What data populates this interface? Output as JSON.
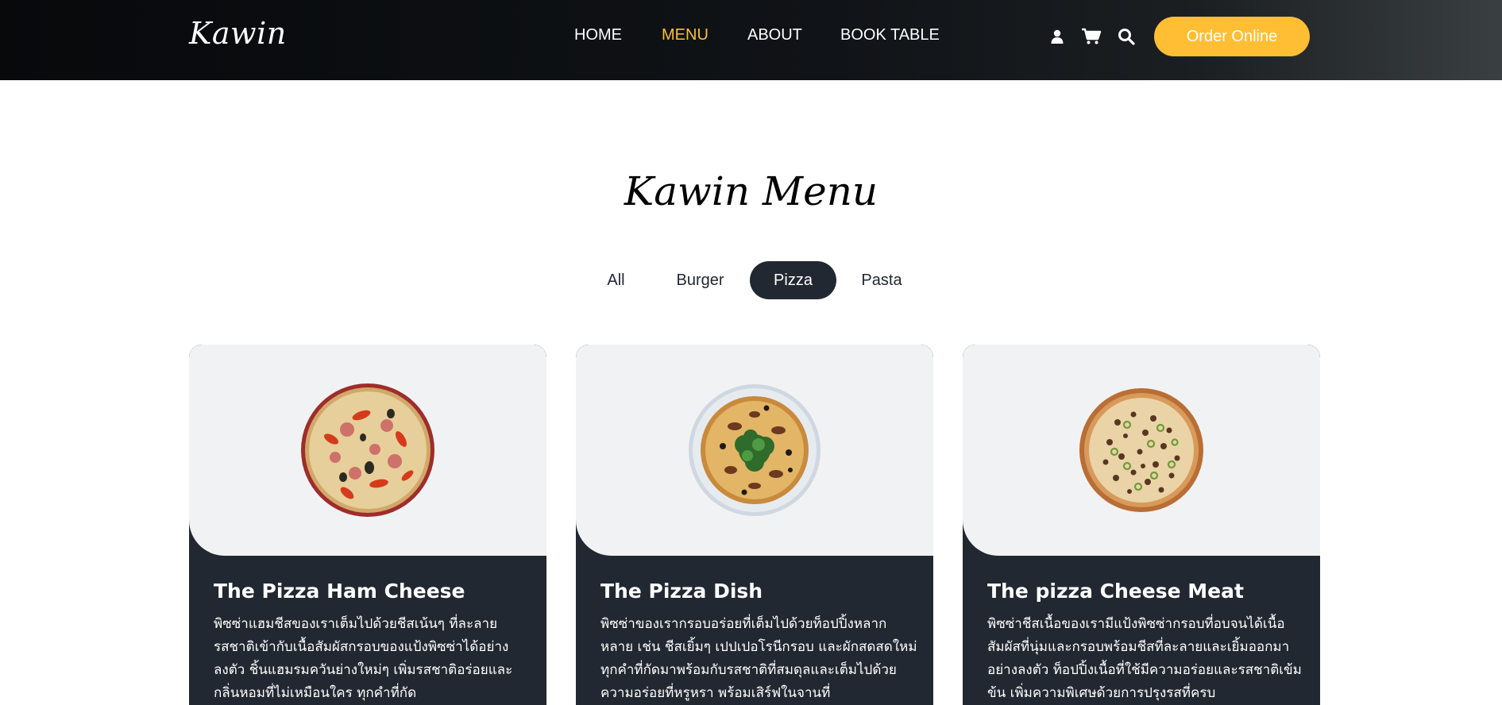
{
  "header": {
    "logo": "Kawin",
    "nav": [
      "HOME",
      "MENU",
      "ABOUT",
      "BOOK TABLE"
    ],
    "active_nav": "MENU",
    "icons": [
      "user-icon",
      "cart-icon",
      "search-icon"
    ],
    "order_button": "Order Online"
  },
  "section": {
    "title": "Kawin Menu",
    "filters": [
      "All",
      "Burger",
      "Pizza",
      "Pasta"
    ],
    "active_filter": "Pizza"
  },
  "colors": {
    "accent": "#ffbe33",
    "dark": "#222831",
    "card_top": "#f1f2f3"
  },
  "cards": [
    {
      "title": "The Pizza Ham Cheese",
      "description": "พิซซ่าแฮมชีสของเราเต็มไปด้วยชีสเน้นๆ ที่ละลายรสชาติเข้ากับเนื้อสัมผัสกรอบของแป้งพิซซ่าได้อย่างลงตัว ชิ้นแฮมรมควันย่างใหม่ๆ เพิ่มรสชาติอร่อยและกลิ่นหอมที่ไม่เหมือนใคร ทุกคำที่กัด",
      "image": "pizza-ham-cheese-image"
    },
    {
      "title": "The Pizza Dish",
      "description": "พิซซ่าของเรากรอบอร่อยที่เต็มไปด้วยท็อปปิ้งหลากหลาย เช่น ชีสเยิ้มๆ เปปเปอโรนีกรอบ และผักสดสดใหม่ ทุกคำที่กัดมาพร้อมกับรสชาติที่สมดุลและเต็มไปด้วยความอร่อยที่หรูหรา พร้อมเสิร์ฟในจานที่",
      "image": "pizza-dish-image"
    },
    {
      "title": "The pizza Cheese Meat",
      "description": "พิซซ่าชีสเนื้อของเรามีแป้งพิซซ่ากรอบที่อบจนได้เนื้อสัมผัสที่นุ่มและกรอบพร้อมชีสที่ละลายและเยิ้มออกมาอย่างลงตัว ท็อปปิ้งเนื้อที่ใช้มีความอร่อยและรสชาติเข้มข้น เพิ่มความพิเศษด้วยการปรุงรสที่ครบ",
      "image": "pizza-cheese-meat-image"
    }
  ]
}
